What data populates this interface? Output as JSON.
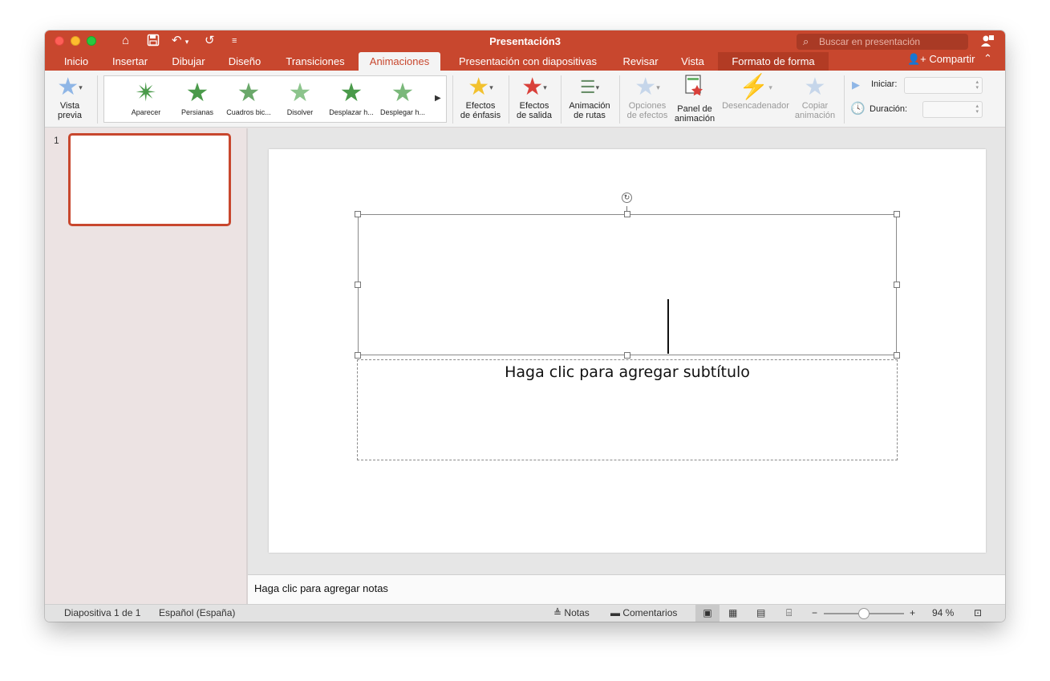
{
  "window": {
    "title": "Presentación3",
    "search_placeholder": "Buscar en presentación",
    "share_label": "Compartir"
  },
  "tabs": [
    "Inicio",
    "Insertar",
    "Dibujar",
    "Diseño",
    "Transiciones",
    "Animaciones",
    "Presentación con diapositivas",
    "Revisar",
    "Vista",
    "Formato de forma"
  ],
  "active_tab": "Animaciones",
  "ribbon": {
    "preview": {
      "line1": "Vista",
      "line2": "previa"
    },
    "gallery": [
      "Aparecer",
      "Persianas",
      "Cuadros bic...",
      "Disolver",
      "Desplazar h...",
      "Desplegar h..."
    ],
    "emphasis": {
      "line1": "Efectos",
      "line2": "de énfasis"
    },
    "exit": {
      "line1": "Efectos",
      "line2": "de salida"
    },
    "paths": {
      "line1": "Animación",
      "line2": "de rutas"
    },
    "effect_options": {
      "line1": "Opciones",
      "line2": "de efectos"
    },
    "anim_pane": {
      "line1": "Panel de",
      "line2": "animación"
    },
    "trigger": "Desencadenador",
    "copy": {
      "line1": "Copiar",
      "line2": "animación"
    },
    "start_label": "Iniciar:",
    "duration_label": "Duración:"
  },
  "slides": [
    {
      "number": "1"
    }
  ],
  "slide": {
    "subtitle_placeholder": "Haga clic para agregar subtítulo"
  },
  "notes_placeholder": "Haga clic para agregar notas",
  "status": {
    "slide_info": "Diapositiva 1 de 1",
    "language": "Español (España)",
    "notes": "Notas",
    "comments": "Comentarios",
    "zoom": "94 %",
    "zoom_fraction": 0.5
  },
  "colors": {
    "accent": "#c8472e",
    "entrance_star": "#4a9a4a",
    "emphasis_star": "#f2c12e",
    "exit_star": "#d9403a"
  }
}
